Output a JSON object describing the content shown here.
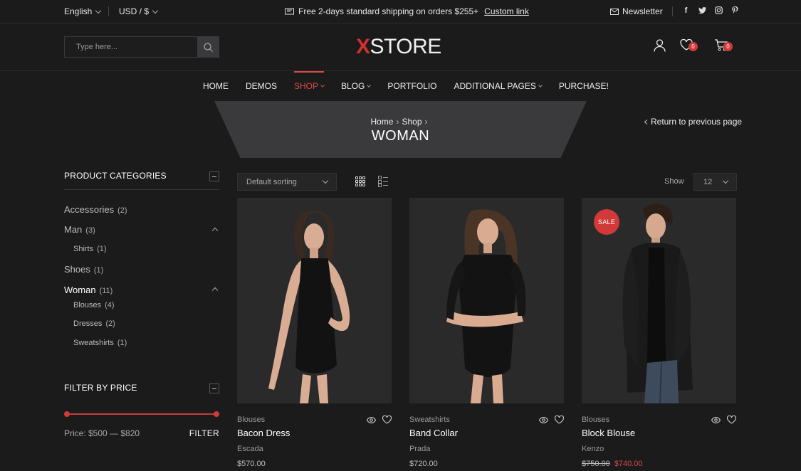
{
  "topbar": {
    "language": "English",
    "currency": "USD / $",
    "promo_text": "Free 2-days standard shipping on orders $255+",
    "promo_link": "Custom link",
    "newsletter": "Newsletter",
    "socials": [
      "facebook-icon",
      "twitter-icon",
      "instagram-icon",
      "pinterest-icon"
    ]
  },
  "header": {
    "search_placeholder": "Type here...",
    "logo_x": "X",
    "logo_rest": "STORE",
    "wishlist_count": "0",
    "cart_count": "0"
  },
  "nav": {
    "items": [
      {
        "label": "HOME"
      },
      {
        "label": "DEMOS"
      },
      {
        "label": "SHOP"
      },
      {
        "label": "BLOG"
      },
      {
        "label": "PORTFOLIO"
      },
      {
        "label": "ADDITIONAL PAGES"
      },
      {
        "label": "PURCHASE!"
      }
    ]
  },
  "breadcrumb": {
    "home": "Home",
    "shop": "Shop",
    "title": "WOMAN",
    "return": "Return to previous page"
  },
  "sidebar": {
    "categories_title": "PRODUCT CATEGORIES",
    "categories": [
      {
        "label": "Accessories",
        "count": "(2)"
      },
      {
        "label": "Man",
        "count": "(3)"
      },
      {
        "label": "Shirts",
        "count": "(1)"
      },
      {
        "label": "Shoes",
        "count": "(1)"
      },
      {
        "label": "Woman",
        "count": "(11)"
      },
      {
        "label": "Blouses",
        "count": "(4)"
      },
      {
        "label": "Dresses",
        "count": "(2)"
      },
      {
        "label": "Sweatshirts",
        "count": "(1)"
      }
    ],
    "price_title": "FILTER BY PRICE",
    "price_label": "Price: $500 — $820",
    "filter_button": "FILTER"
  },
  "toolbar": {
    "sorting": "Default sorting",
    "show_label": "Show",
    "show_value": "12"
  },
  "products": [
    {
      "category": "Blouses",
      "name": "Bacon Dress",
      "brand": "Escada",
      "price": "$570.00"
    },
    {
      "category": "Sweatshirts",
      "name": "Band Collar",
      "brand": "Prada",
      "price": "$720.00"
    },
    {
      "category": "Blouses",
      "name": "Block Blouse",
      "brand": "Kenzo",
      "old_price": "$750.00",
      "price": "$740.00",
      "badge": "SALE"
    }
  ],
  "colors": {
    "accent": "#d23a3a",
    "background": "#1b1b1c"
  }
}
